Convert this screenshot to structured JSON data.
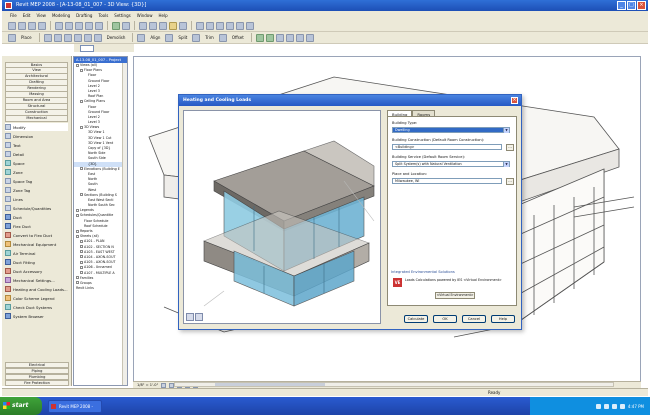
{
  "window": {
    "title": "Revit MEP 2008 - [A-13-08_01_007 - 3D View: {3D}]"
  },
  "menu": [
    "File",
    "Edit",
    "View",
    "Modeling",
    "Drafting",
    "Tools",
    "Settings",
    "Window",
    "Help"
  ],
  "toolbar2": {
    "place_label": "Place",
    "demolish_label": "Demolish",
    "align_label": "Align",
    "split_label": "Split",
    "trim_label": "Trim",
    "offset_label": "Offset"
  },
  "design_bar": {
    "tabs": [
      "Basics",
      "View",
      "Architectural",
      "Drafting",
      "Rendering",
      "Massing",
      "Room and Area",
      "Structural",
      "Construction",
      "Mechanical"
    ],
    "items": [
      {
        "label": "Modify",
        "icon": "arrow-icon"
      },
      {
        "label": "Dimension",
        "icon": "dimension-icon"
      },
      {
        "label": "Text",
        "icon": "text-icon"
      },
      {
        "label": "Detail",
        "icon": "detail-icon"
      },
      {
        "label": "Space",
        "icon": "space-icon"
      },
      {
        "label": "Zone",
        "icon": "zone-icon"
      },
      {
        "label": "Space Tag",
        "icon": "tag-icon"
      },
      {
        "label": "Zone Tag",
        "icon": "tag-icon"
      },
      {
        "label": "Lines",
        "icon": "lines-icon"
      },
      {
        "label": "Schedule/Quantities",
        "icon": "schedule-icon"
      },
      {
        "label": "Duct",
        "icon": "duct-icon"
      },
      {
        "label": "Flex Duct",
        "icon": "flex-duct-icon"
      },
      {
        "label": "Convert to Flex Duct",
        "icon": "convert-icon"
      },
      {
        "label": "Mechanical Equipment",
        "icon": "equipment-icon"
      },
      {
        "label": "Air Terminal",
        "icon": "air-terminal-icon"
      },
      {
        "label": "Duct Fitting",
        "icon": "fitting-icon"
      },
      {
        "label": "Duct Accessory",
        "icon": "accessory-icon"
      },
      {
        "label": "Mechanical Settings...",
        "icon": "settings-icon"
      },
      {
        "label": "Heating and Cooling Loads...",
        "icon": "loads-icon"
      },
      {
        "label": "Color Scheme Legend",
        "icon": "legend-icon"
      },
      {
        "label": "Check Duct Systems",
        "icon": "check-icon"
      },
      {
        "label": "System Browser",
        "icon": "browser-icon"
      }
    ],
    "bottom_tabs": [
      "Electrical",
      "Piping",
      "Plumbing",
      "Fire Protection"
    ]
  },
  "project_browser": {
    "header": "A-13-08_01_007 - Project",
    "rows": [
      {
        "label": "Views (all)",
        "indent": 0,
        "exp": true
      },
      {
        "label": "Floor Plans",
        "indent": 1,
        "exp": true
      },
      {
        "label": "Floor",
        "indent": 3
      },
      {
        "label": "Ground Floor",
        "indent": 3
      },
      {
        "label": "Level 2",
        "indent": 3
      },
      {
        "label": "Level 3",
        "indent": 3
      },
      {
        "label": "Roof Plan",
        "indent": 3
      },
      {
        "label": "Ceiling Plans",
        "indent": 1,
        "exp": true
      },
      {
        "label": "Floor",
        "indent": 3
      },
      {
        "label": "Ground Floor",
        "indent": 3
      },
      {
        "label": "Level 2",
        "indent": 3
      },
      {
        "label": "Level 3",
        "indent": 3
      },
      {
        "label": "3D Views",
        "indent": 1,
        "exp": true
      },
      {
        "label": "3D View 1",
        "indent": 3
      },
      {
        "label": "3D View 1 Cut",
        "indent": 3
      },
      {
        "label": "3D View 1 Vent",
        "indent": 3
      },
      {
        "label": "Copy of {3D}",
        "indent": 3
      },
      {
        "label": "North Side",
        "indent": 3
      },
      {
        "label": "South Side",
        "indent": 3
      },
      {
        "label": "{3D}",
        "indent": 3,
        "sel": true
      },
      {
        "label": "Elevations (Building E",
        "indent": 1,
        "exp": true
      },
      {
        "label": "East",
        "indent": 3
      },
      {
        "label": "North",
        "indent": 3
      },
      {
        "label": "South",
        "indent": 3
      },
      {
        "label": "West",
        "indent": 3
      },
      {
        "label": "Sections (Building S",
        "indent": 1,
        "exp": true
      },
      {
        "label": "East West Secti",
        "indent": 3
      },
      {
        "label": "North South Sec",
        "indent": 3
      },
      {
        "label": "Legends",
        "indent": 0,
        "exp": true
      },
      {
        "label": "Schedules/Quantitie",
        "indent": 0,
        "exp": true
      },
      {
        "label": "Floor Schedule",
        "indent": 2
      },
      {
        "label": "Roof Schedule",
        "indent": 2
      },
      {
        "label": "Reports",
        "indent": 0,
        "exp": true
      },
      {
        "label": "Sheets (all)",
        "indent": 0,
        "exp": true
      },
      {
        "label": "A101 - PLAN",
        "indent": 1,
        "exp": true
      },
      {
        "label": "A102 - SECTION N",
        "indent": 1,
        "exp": true
      },
      {
        "label": "A103 - EAST WEST",
        "indent": 1,
        "exp": true
      },
      {
        "label": "A104 - AXON-SOUT",
        "indent": 1,
        "exp": true
      },
      {
        "label": "A105 - AXON-SOUT",
        "indent": 1,
        "exp": true
      },
      {
        "label": "A106 - Unnamed",
        "indent": 1,
        "exp": true
      },
      {
        "label": "A107 - MULTIPLE A",
        "indent": 1,
        "exp": true
      },
      {
        "label": "Families",
        "indent": 0,
        "exp": true
      },
      {
        "label": "Groups",
        "indent": 0,
        "exp": true
      },
      {
        "label": "Revit Links",
        "indent": 0
      }
    ]
  },
  "view_control": {
    "scale": "1/8\" = 1'-0\""
  },
  "status": {
    "text": "Ready"
  },
  "taskbar": {
    "start": "start",
    "task": "Revit MEP 2008 - [A-...",
    "clock": "4:47 PM"
  },
  "dialog": {
    "title": "Heating and Cooling Loads",
    "tabs": [
      "Building",
      "Rooms"
    ],
    "fields": [
      {
        "label": "Building Type:",
        "value": "Dwelling",
        "highlight": true,
        "dots": false
      },
      {
        "label": "Building Construction (Default Room Construction):",
        "value": "<Building>",
        "highlight": false,
        "dots": true
      },
      {
        "label": "Building Service (Default Room Service):",
        "value": "Split System(s) with Natural Ventilation",
        "highlight": false,
        "dots": false
      },
      {
        "label": "Place and Location:",
        "value": "Milwaukee, WI",
        "highlight": false,
        "dots": true
      }
    ],
    "ies": {
      "title": "Integrated Environmental Solutions",
      "logo": "VE",
      "text": "Loads Calculations powered by IES <Virtual Environment>",
      "button": "<Virtual Environment>"
    },
    "buttons": [
      "Calculate",
      "OK",
      "Cancel",
      "Help"
    ]
  },
  "colors": {
    "titlebar": "#2659c4",
    "glass": "#7fc0dc",
    "wall": "#9a9590",
    "selection": "#316ac5"
  }
}
